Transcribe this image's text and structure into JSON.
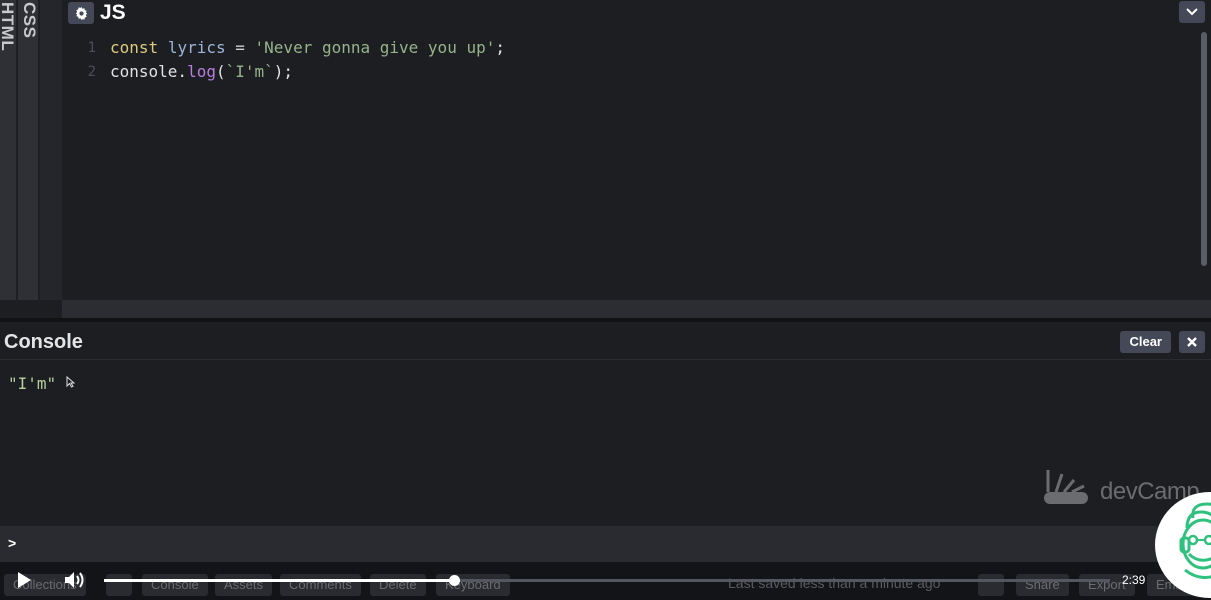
{
  "side_tabs": {
    "html_label": "HTML",
    "css_label": "CSS"
  },
  "js_editor": {
    "title": "JS",
    "line_numbers": [
      "1",
      "2"
    ],
    "code_line1": {
      "kw": "const",
      "var": "lyrics",
      "op": "=",
      "str": "'Never gonna give you up'",
      "end": ";"
    },
    "code_line2": {
      "obj": "console.",
      "fn": "log",
      "open": "(",
      "str": "`I'm`",
      "close": ");"
    }
  },
  "console": {
    "title": "Console",
    "clear_label": "Clear",
    "output": "\"I'm\"",
    "prompt": ">"
  },
  "watermark": {
    "text": "devCamp"
  },
  "footer": {
    "buttons": [
      "Collections",
      "Console",
      "Assets",
      "Comments",
      "Delete",
      "Keyboard",
      "Share",
      "Export",
      "Embed"
    ],
    "status": "Last saved less than a minute ago"
  },
  "video": {
    "progress_fraction": 0.348,
    "time": "2:39"
  },
  "colors": {
    "keyword": "#ddca7e",
    "variable": "#9cb4d8",
    "string": "#96b38a",
    "function": "#b77fdb",
    "background": "#1d1e22",
    "accent_green": "#2ec27e"
  }
}
